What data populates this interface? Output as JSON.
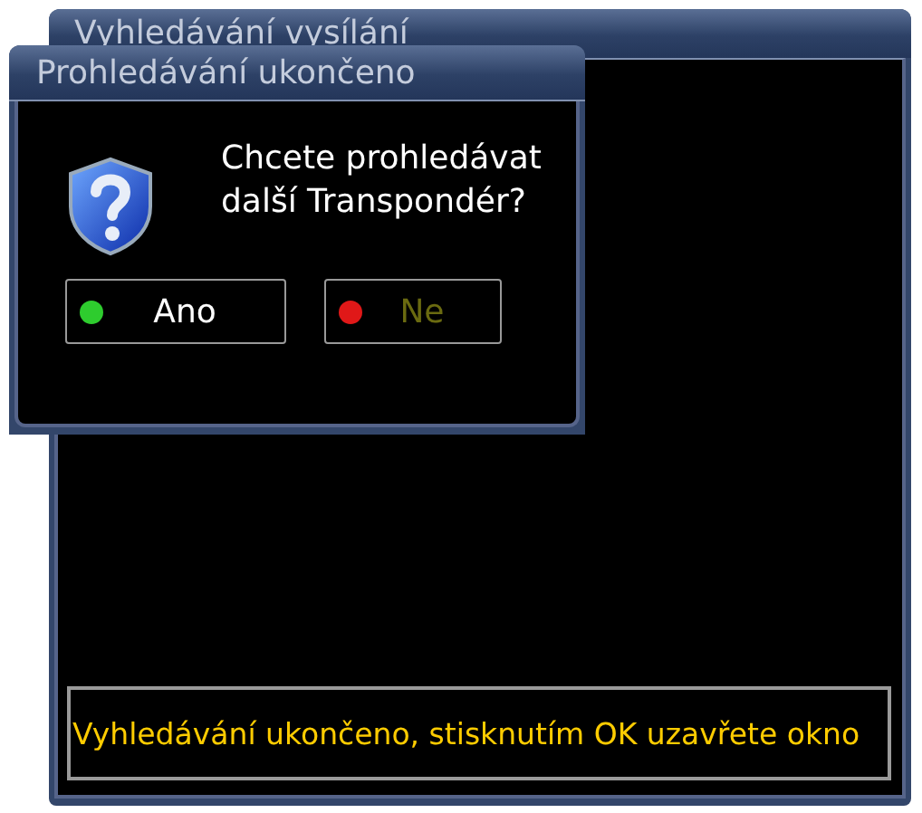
{
  "window": {
    "title": "Vyhledávání vysílání",
    "status_message": "Vyhledávání ukončeno, stisknutím OK uzavřete okno"
  },
  "dialog": {
    "title": "Prohledávání ukončeno",
    "message": "Chcete prohledávat další Transpondér?",
    "buttons": [
      {
        "label": "Ano",
        "color": "#2ecc2e",
        "disabled": false
      },
      {
        "label": "Ne",
        "color": "#e01818",
        "disabled": true
      }
    ]
  }
}
